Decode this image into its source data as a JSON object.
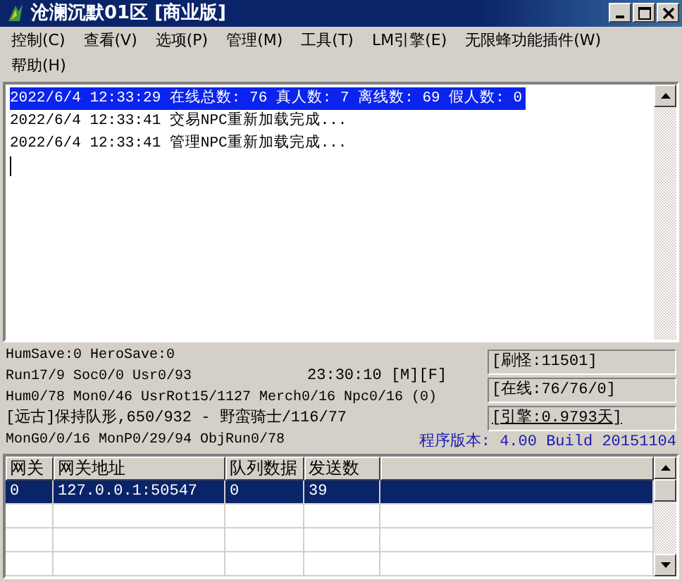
{
  "window": {
    "title": "沧澜沉默01区 [商业版]"
  },
  "menu": [
    {
      "label": "控制(C)"
    },
    {
      "label": "查看(V)"
    },
    {
      "label": "选项(P)"
    },
    {
      "label": "管理(M)"
    },
    {
      "label": "工具(T)"
    },
    {
      "label": "LM引擎(E)"
    },
    {
      "label": "无限蜂功能插件(W)"
    },
    {
      "label": "帮助(H)"
    }
  ],
  "log": [
    {
      "text": "2022/6/4 12:33:29 在线总数: 76 真人数: 7 离线数: 69 假人数: 0",
      "selected": true
    },
    {
      "text": "2022/6/4 12:33:41 交易NPC重新加载完成...",
      "selected": false
    },
    {
      "text": "2022/6/4 12:33:41 管理NPC重新加载完成...",
      "selected": false
    }
  ],
  "status": {
    "lines": [
      {
        "text": "HumSave:0 HeroSave:0"
      },
      {
        "text": "Run17/9 Soc0/0 Usr0/93",
        "time": "23:30:10 [M][F]"
      },
      {
        "text": "Hum0/78 Mon0/46 UsrRot15/1127 Merch0/16 Npc0/16 (0)"
      },
      {
        "text": "[远古]保持队形,650/932 - 野蛮骑士/116/77"
      },
      {
        "text": "MonG0/0/16 MonP0/29/94 ObjRun0/78"
      }
    ],
    "panels": [
      {
        "text": "[刷怪:11501]",
        "underline": false
      },
      {
        "text": "[在线:76/76/0]",
        "underline": false
      },
      {
        "text": "[引擎:0.9793天]",
        "underline": true
      }
    ],
    "version": "程序版本: 4.00 Build 20151104"
  },
  "table": {
    "columns": [
      "网关",
      "网关地址",
      "队列数据",
      "发送数"
    ],
    "rows": [
      {
        "cells": [
          "0",
          "127.0.0.1:50547",
          "0",
          "39"
        ],
        "selected": true
      }
    ]
  }
}
